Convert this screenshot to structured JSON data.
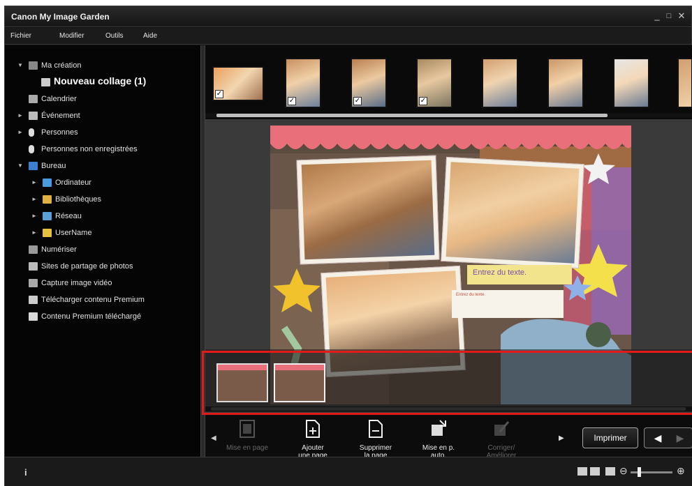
{
  "window": {
    "title": "Canon My Image Garden",
    "controls": {
      "minimize": "_",
      "maximize": "□",
      "close": "✕"
    }
  },
  "menu": [
    "Fichier",
    "Modifier",
    "Outils",
    "Aide"
  ],
  "sidebar": {
    "items": [
      {
        "label": "Ma création",
        "icon": "creation-icon",
        "expander": "▼"
      },
      {
        "label": "Nouveau collage (1)",
        "icon": "collage-icon"
      },
      {
        "label": "Calendrier",
        "icon": "calendar-icon"
      },
      {
        "label": "Événement",
        "icon": "event-icon",
        "expander": "►"
      },
      {
        "label": "Personnes",
        "icon": "person-icon",
        "expander": "►"
      },
      {
        "label": "Personnes non enregistrées",
        "icon": "unregistered-person-icon"
      },
      {
        "label": "Bureau",
        "icon": "desktop-icon",
        "expander": "▼"
      },
      {
        "label": "Ordinateur",
        "icon": "computer-icon",
        "expander": "►"
      },
      {
        "label": "Bibliothèques",
        "icon": "libraries-icon",
        "expander": "►"
      },
      {
        "label": "Réseau",
        "icon": "network-icon",
        "expander": "►"
      },
      {
        "label": "UserName",
        "icon": "user-folder-icon",
        "expander": "►"
      },
      {
        "label": "Numériser",
        "icon": "scan-icon"
      },
      {
        "label": "Sites de partage de photos",
        "icon": "photo-sharing-icon"
      },
      {
        "label": "Capture image vidéo",
        "icon": "video-capture-icon"
      },
      {
        "label": "Télécharger contenu Premium",
        "icon": "download-premium-icon"
      },
      {
        "label": "Contenu Premium téléchargé",
        "icon": "premium-folder-icon"
      }
    ]
  },
  "collage": {
    "text_placeholder_large": "Entrez du texte.",
    "text_placeholder_small": "Entrez du texte."
  },
  "toolbar": {
    "buttons": [
      {
        "label_line1": "Mise en page",
        "label_line2": "",
        "enabled": false
      },
      {
        "label_line1": "Ajouter",
        "label_line2": "une page",
        "enabled": true
      },
      {
        "label_line1": "Supprimer",
        "label_line2": "la page",
        "enabled": true
      },
      {
        "label_line1": "Mise en p.",
        "label_line2": "auto.",
        "enabled": true
      },
      {
        "label_line1": "Corriger/",
        "label_line2": "Améliorer",
        "enabled": false
      }
    ],
    "print_label": "Imprimer",
    "prev_arrow": "◀",
    "next_arrow": "▶",
    "scroll_left": "◀",
    "scroll_right": "▶"
  },
  "status": {
    "info_icon_text": "i"
  },
  "colors": {
    "highlight_box": "#e21a1a",
    "collage_banner": "#e96f7a",
    "textbox_yellow": "#f2e38d",
    "textbox_text": "#7a4fa8"
  }
}
